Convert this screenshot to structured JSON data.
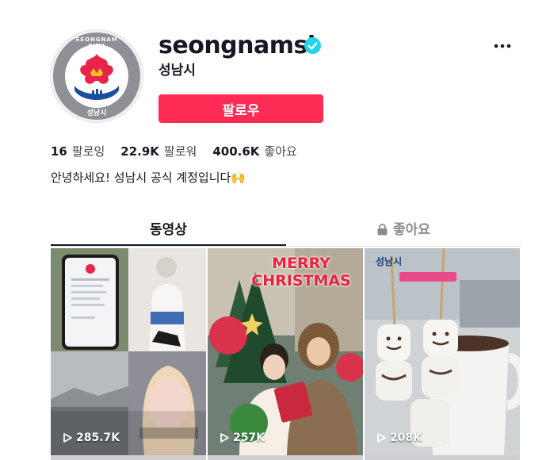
{
  "profile": {
    "username": "seongnamsi",
    "nickname": "성남시",
    "avatar_text_top": "SEONGNAM CITY",
    "avatar_text_bottom": "성남시",
    "verified": true,
    "follow_label": "팔로우",
    "more_icon": "ellipsis-icon"
  },
  "stats": [
    {
      "count": "16",
      "label": "팔로잉"
    },
    {
      "count": "22.9K",
      "label": "팔로워"
    },
    {
      "count": "400.6K",
      "label": "좋아요"
    }
  ],
  "bio": "안녕하세요! 성남시 공식 계정입니다🙌",
  "tabs": {
    "videos": "동영상",
    "likes": "좋아요",
    "likes_icon": "lock-icon"
  },
  "videos": [
    {
      "views": "285.7K"
    },
    {
      "views": "257K",
      "overlay_line1": "MERRY",
      "overlay_line2": "CHRISTMAS"
    },
    {
      "views": "208K",
      "overlay_badge": "성남시"
    }
  ],
  "colors": {
    "accent": "#fe2c55",
    "verified": "#20d5ec",
    "text": "#161823",
    "muted": "#8a8b91"
  }
}
